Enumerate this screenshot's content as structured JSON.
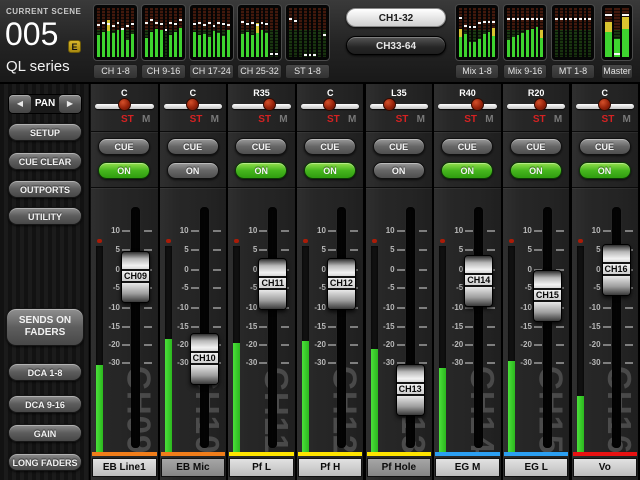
{
  "scene": {
    "label": "CURRENT SCENE",
    "number": "005",
    "edit_badge": "E",
    "model": "QL series"
  },
  "top": {
    "bank_buttons": [
      {
        "label": "CH1-32",
        "active": true
      },
      {
        "label": "CH33-64",
        "active": false
      }
    ],
    "meter_blocks_left": [
      {
        "label": "CH 1-8",
        "bars": [
          {
            "level": 0.45,
            "yellow": false,
            "mark": 0.66
          },
          {
            "level": 0.52,
            "yellow": false,
            "mark": 0.7
          },
          {
            "level": 0.75,
            "yellow": true,
            "mark": 0.68
          },
          {
            "level": 0.48,
            "yellow": false,
            "mark": 0.63
          },
          {
            "level": 0.55,
            "yellow": false,
            "mark": 0.7
          },
          {
            "level": 0.6,
            "yellow": false,
            "mark": 0.58
          },
          {
            "level": 0.34,
            "yellow": false,
            "mark": 0.64
          },
          {
            "level": 0.46,
            "yellow": false,
            "mark": 0.68
          }
        ]
      },
      {
        "label": "CH 9-16",
        "bars": [
          {
            "level": 0.38,
            "yellow": false,
            "mark": 0.7
          },
          {
            "level": 0.52,
            "yellow": false,
            "mark": 0.75
          },
          {
            "level": 0.58,
            "yellow": false,
            "mark": 0.7
          },
          {
            "level": 0.55,
            "yellow": false,
            "mark": 0.67
          },
          {
            "level": 0.0,
            "yellow": false,
            "mark": 0.55
          },
          {
            "level": 0.45,
            "yellow": false,
            "mark": 0.7
          },
          {
            "level": 0.52,
            "yellow": false,
            "mark": 0.68
          },
          {
            "level": 0.6,
            "yellow": false,
            "mark": 0.75
          }
        ]
      },
      {
        "label": "CH 17-24",
        "bars": [
          {
            "level": 0.52,
            "yellow": false,
            "mark": 0.68
          },
          {
            "level": 0.44,
            "yellow": false,
            "mark": 0.7
          },
          {
            "level": 0.46,
            "yellow": false,
            "mark": 0.66
          },
          {
            "level": 0.4,
            "yellow": false,
            "mark": 0.7
          },
          {
            "level": 0.54,
            "yellow": false,
            "mark": 0.64
          },
          {
            "level": 0.5,
            "yellow": false,
            "mark": 0.7
          },
          {
            "level": 0.42,
            "yellow": false,
            "mark": 0.68
          },
          {
            "level": 0.56,
            "yellow": false,
            "mark": 0.66
          }
        ]
      },
      {
        "label": "CH 25-32",
        "bars": [
          {
            "level": 0.46,
            "yellow": false,
            "mark": 0.72
          },
          {
            "level": 0.52,
            "yellow": false,
            "mark": 0.68
          },
          {
            "level": 0.44,
            "yellow": false,
            "mark": 0.7
          },
          {
            "level": 0.7,
            "yellow": true,
            "mark": 0.66
          },
          {
            "level": 0.56,
            "yellow": false,
            "mark": 0.7
          },
          {
            "level": 0.5,
            "yellow": false,
            "mark": 0.68
          },
          {
            "level": 0.0,
            "yellow": false,
            "mark": 0.06
          },
          {
            "level": 0.0,
            "yellow": false,
            "mark": 0.06
          }
        ]
      },
      {
        "label": "ST 1-8",
        "bars": [
          {
            "level": 0.0,
            "yellow": false,
            "mark": 0.78
          },
          {
            "level": 0.0,
            "yellow": false,
            "mark": 0.74
          },
          {
            "level": 0.0,
            "yellow": false,
            "mark": null
          },
          {
            "level": 0.0,
            "yellow": false,
            "mark": 0.05
          },
          {
            "level": 0.0,
            "yellow": false,
            "mark": 0.05
          },
          {
            "level": 0.0,
            "yellow": false,
            "mark": 0.05
          },
          {
            "level": 0.0,
            "yellow": false,
            "mark": null
          },
          {
            "level": 0.0,
            "yellow": false,
            "mark": 0.45
          }
        ]
      }
    ],
    "meter_blocks_right": [
      {
        "label": "Mix 1-8",
        "bars": [
          {
            "level": 0.58,
            "yellow": true,
            "mark": 0.8
          },
          {
            "level": 0.46,
            "yellow": false,
            "mark": 0.64
          },
          {
            "level": 0.3,
            "yellow": false,
            "mark": 0.62
          },
          {
            "level": 0.3,
            "yellow": false,
            "mark": 0.62
          },
          {
            "level": 0.36,
            "yellow": false,
            "mark": 0.7
          },
          {
            "level": 0.46,
            "yellow": false,
            "mark": 0.72
          },
          {
            "level": 0.52,
            "yellow": false,
            "mark": 0.72
          },
          {
            "level": 0.6,
            "yellow": true,
            "mark": 0.72
          }
        ]
      },
      {
        "label": "Mix 9-16",
        "bars": [
          {
            "level": 0.35,
            "yellow": false,
            "mark": 0.78
          },
          {
            "level": 0.4,
            "yellow": false,
            "mark": 0.78
          },
          {
            "level": 0.45,
            "yellow": false,
            "mark": 0.78
          },
          {
            "level": 0.5,
            "yellow": false,
            "mark": 0.78
          },
          {
            "level": 0.55,
            "yellow": false,
            "mark": 0.78
          },
          {
            "level": 0.58,
            "yellow": false,
            "mark": 0.78
          },
          {
            "level": 0.62,
            "yellow": false,
            "mark": 0.78
          },
          {
            "level": 0.56,
            "yellow": true,
            "mark": 0.78
          }
        ]
      },
      {
        "label": "MT 1-8",
        "bars": [
          {
            "level": 0.0,
            "yellow": false,
            "mark": 0.78
          },
          {
            "level": 0.0,
            "yellow": false,
            "mark": 0.78
          },
          {
            "level": 0.0,
            "yellow": false,
            "mark": 0.78
          },
          {
            "level": 0.0,
            "yellow": false,
            "mark": 0.78
          },
          {
            "level": 0.0,
            "yellow": false,
            "mark": 0.78
          },
          {
            "level": 0.0,
            "yellow": false,
            "mark": 0.78
          },
          {
            "level": 0.0,
            "yellow": false,
            "mark": 0.78
          },
          {
            "level": 0.0,
            "yellow": false,
            "mark": 0.78
          }
        ]
      },
      {
        "label": "Master",
        "bars": [
          {
            "level": 0.72,
            "yellow": true,
            "mark": 0.85
          },
          {
            "level": 0.36,
            "yellow": false,
            "mark": 0.06
          },
          {
            "level": 0.82,
            "yellow": true,
            "mark": 0.85
          }
        ]
      }
    ]
  },
  "sidebar": {
    "pan_nav": {
      "label": "PAN",
      "left_arrow": "◀",
      "right_arrow": "▶"
    },
    "buttons": [
      {
        "label": "SETUP",
        "name": "setup-button"
      },
      {
        "label": "CUE CLEAR",
        "name": "cue-clear-button"
      },
      {
        "label": "OUTPORTS",
        "name": "outports-button"
      },
      {
        "label": "UTILITY",
        "name": "utility-button"
      }
    ],
    "sends_on_faders": "SENDS ON FADERS",
    "lower_buttons": [
      {
        "label": "DCA 1-8",
        "name": "dca-1-8-button"
      },
      {
        "label": "DCA 9-16",
        "name": "dca-9-16-button"
      },
      {
        "label": "GAIN",
        "name": "gain-button"
      },
      {
        "label": "LONG FADERS",
        "name": "long-faders-button"
      }
    ]
  },
  "strips": {
    "cue_label": "CUE",
    "on_label": "ON",
    "st_label": "ST",
    "mono_label": "M",
    "scale_labels": [
      "10",
      "5",
      "0",
      "-5",
      "-10",
      "-15",
      "-20",
      "-30"
    ],
    "channels": [
      {
        "id": "CH09",
        "pan_label": "C",
        "pan": 0,
        "cue": false,
        "on": true,
        "fader_db": -2,
        "meter": 0.42,
        "name": "EB Line1",
        "color": "#f07d1a",
        "dim": false
      },
      {
        "id": "CH10",
        "pan_label": "C",
        "pan": 0,
        "cue": false,
        "on": false,
        "fader_db": -28,
        "meter": 0.55,
        "name": "EB Mic",
        "color": "#f07d1a",
        "dim": true
      },
      {
        "id": "CH11",
        "pan_label": "R35",
        "pan": 35,
        "cue": false,
        "on": true,
        "fader_db": -4,
        "meter": 0.53,
        "name": "Pf L",
        "color": "#ffe400",
        "dim": false
      },
      {
        "id": "CH12",
        "pan_label": "C",
        "pan": 0,
        "cue": false,
        "on": true,
        "fader_db": -4,
        "meter": 0.54,
        "name": "Pf H",
        "color": "#ffe400",
        "dim": false
      },
      {
        "id": "CH13",
        "pan_label": "L35",
        "pan": -35,
        "cue": false,
        "on": false,
        "fader_db": -40,
        "meter": 0.5,
        "name": "Pf Hole",
        "color": "#ffe400",
        "dim": true
      },
      {
        "id": "CH14",
        "pan_label": "R40",
        "pan": 40,
        "cue": false,
        "on": true,
        "fader_db": -3,
        "meter": 0.41,
        "name": "EG M",
        "color": "#2b9ff2",
        "dim": false
      },
      {
        "id": "CH15",
        "pan_label": "R20",
        "pan": 20,
        "cue": false,
        "on": true,
        "fader_db": -7,
        "meter": 0.44,
        "name": "EG L",
        "color": "#2b9ff2",
        "dim": false
      },
      {
        "id": "CH16",
        "pan_label": "C",
        "pan": 0,
        "cue": false,
        "on": true,
        "fader_db": 0,
        "meter": 0.27,
        "name": "Vo",
        "color": "#e81212",
        "dim": false
      }
    ]
  },
  "colors": {
    "meter_green": "#3ed32f",
    "meter_yellow": "#d9c430",
    "on_green": "#46b61e",
    "st_red": "#d42222",
    "edit_badge_gold": "#c7a418"
  }
}
